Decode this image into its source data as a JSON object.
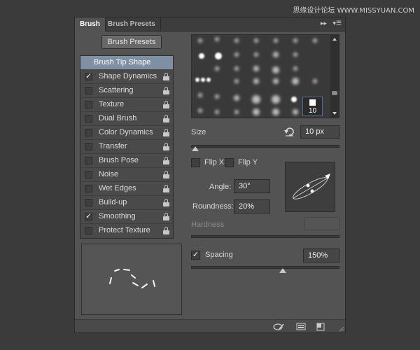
{
  "watermark": "思缘设计论坛 WWW.MISSYUAN.COM",
  "tabs": [
    "Brush",
    "Brush Presets"
  ],
  "brush_presets_button": "Brush Presets",
  "options": [
    {
      "label": "Brush Tip Shape",
      "selected": true
    },
    {
      "label": "Shape Dynamics",
      "checked": true
    },
    {
      "label": "Scattering",
      "checked": false
    },
    {
      "label": "Texture",
      "checked": false
    },
    {
      "label": "Dual Brush",
      "checked": false
    },
    {
      "label": "Color Dynamics",
      "checked": false
    },
    {
      "label": "Transfer",
      "checked": false
    },
    {
      "label": "Brush Pose",
      "checked": false
    },
    {
      "label": "Noise",
      "checked": false
    },
    {
      "label": "Wet Edges",
      "checked": false
    },
    {
      "label": "Build-up",
      "checked": false
    },
    {
      "label": "Smoothing",
      "checked": true
    },
    {
      "label": "Protect Texture",
      "checked": false
    }
  ],
  "tip_grid": {
    "selected_size": "10"
  },
  "size": {
    "label": "Size",
    "value": "10 px",
    "slider_fraction": 0.03
  },
  "flip_x": {
    "label": "Flip X",
    "checked": false
  },
  "flip_y": {
    "label": "Flip Y",
    "checked": false
  },
  "angle": {
    "label": "Angle:",
    "value": "30°"
  },
  "roundness": {
    "label": "Roundness:",
    "value": "20%"
  },
  "hardness": {
    "label": "Hardness",
    "value": ""
  },
  "spacing": {
    "label": "Spacing",
    "checked": true,
    "value": "150%",
    "slider_fraction": 0.62
  },
  "colors": {
    "selection": "#7f8fa4",
    "panel": "#535353",
    "background": "#3b3b3b"
  }
}
